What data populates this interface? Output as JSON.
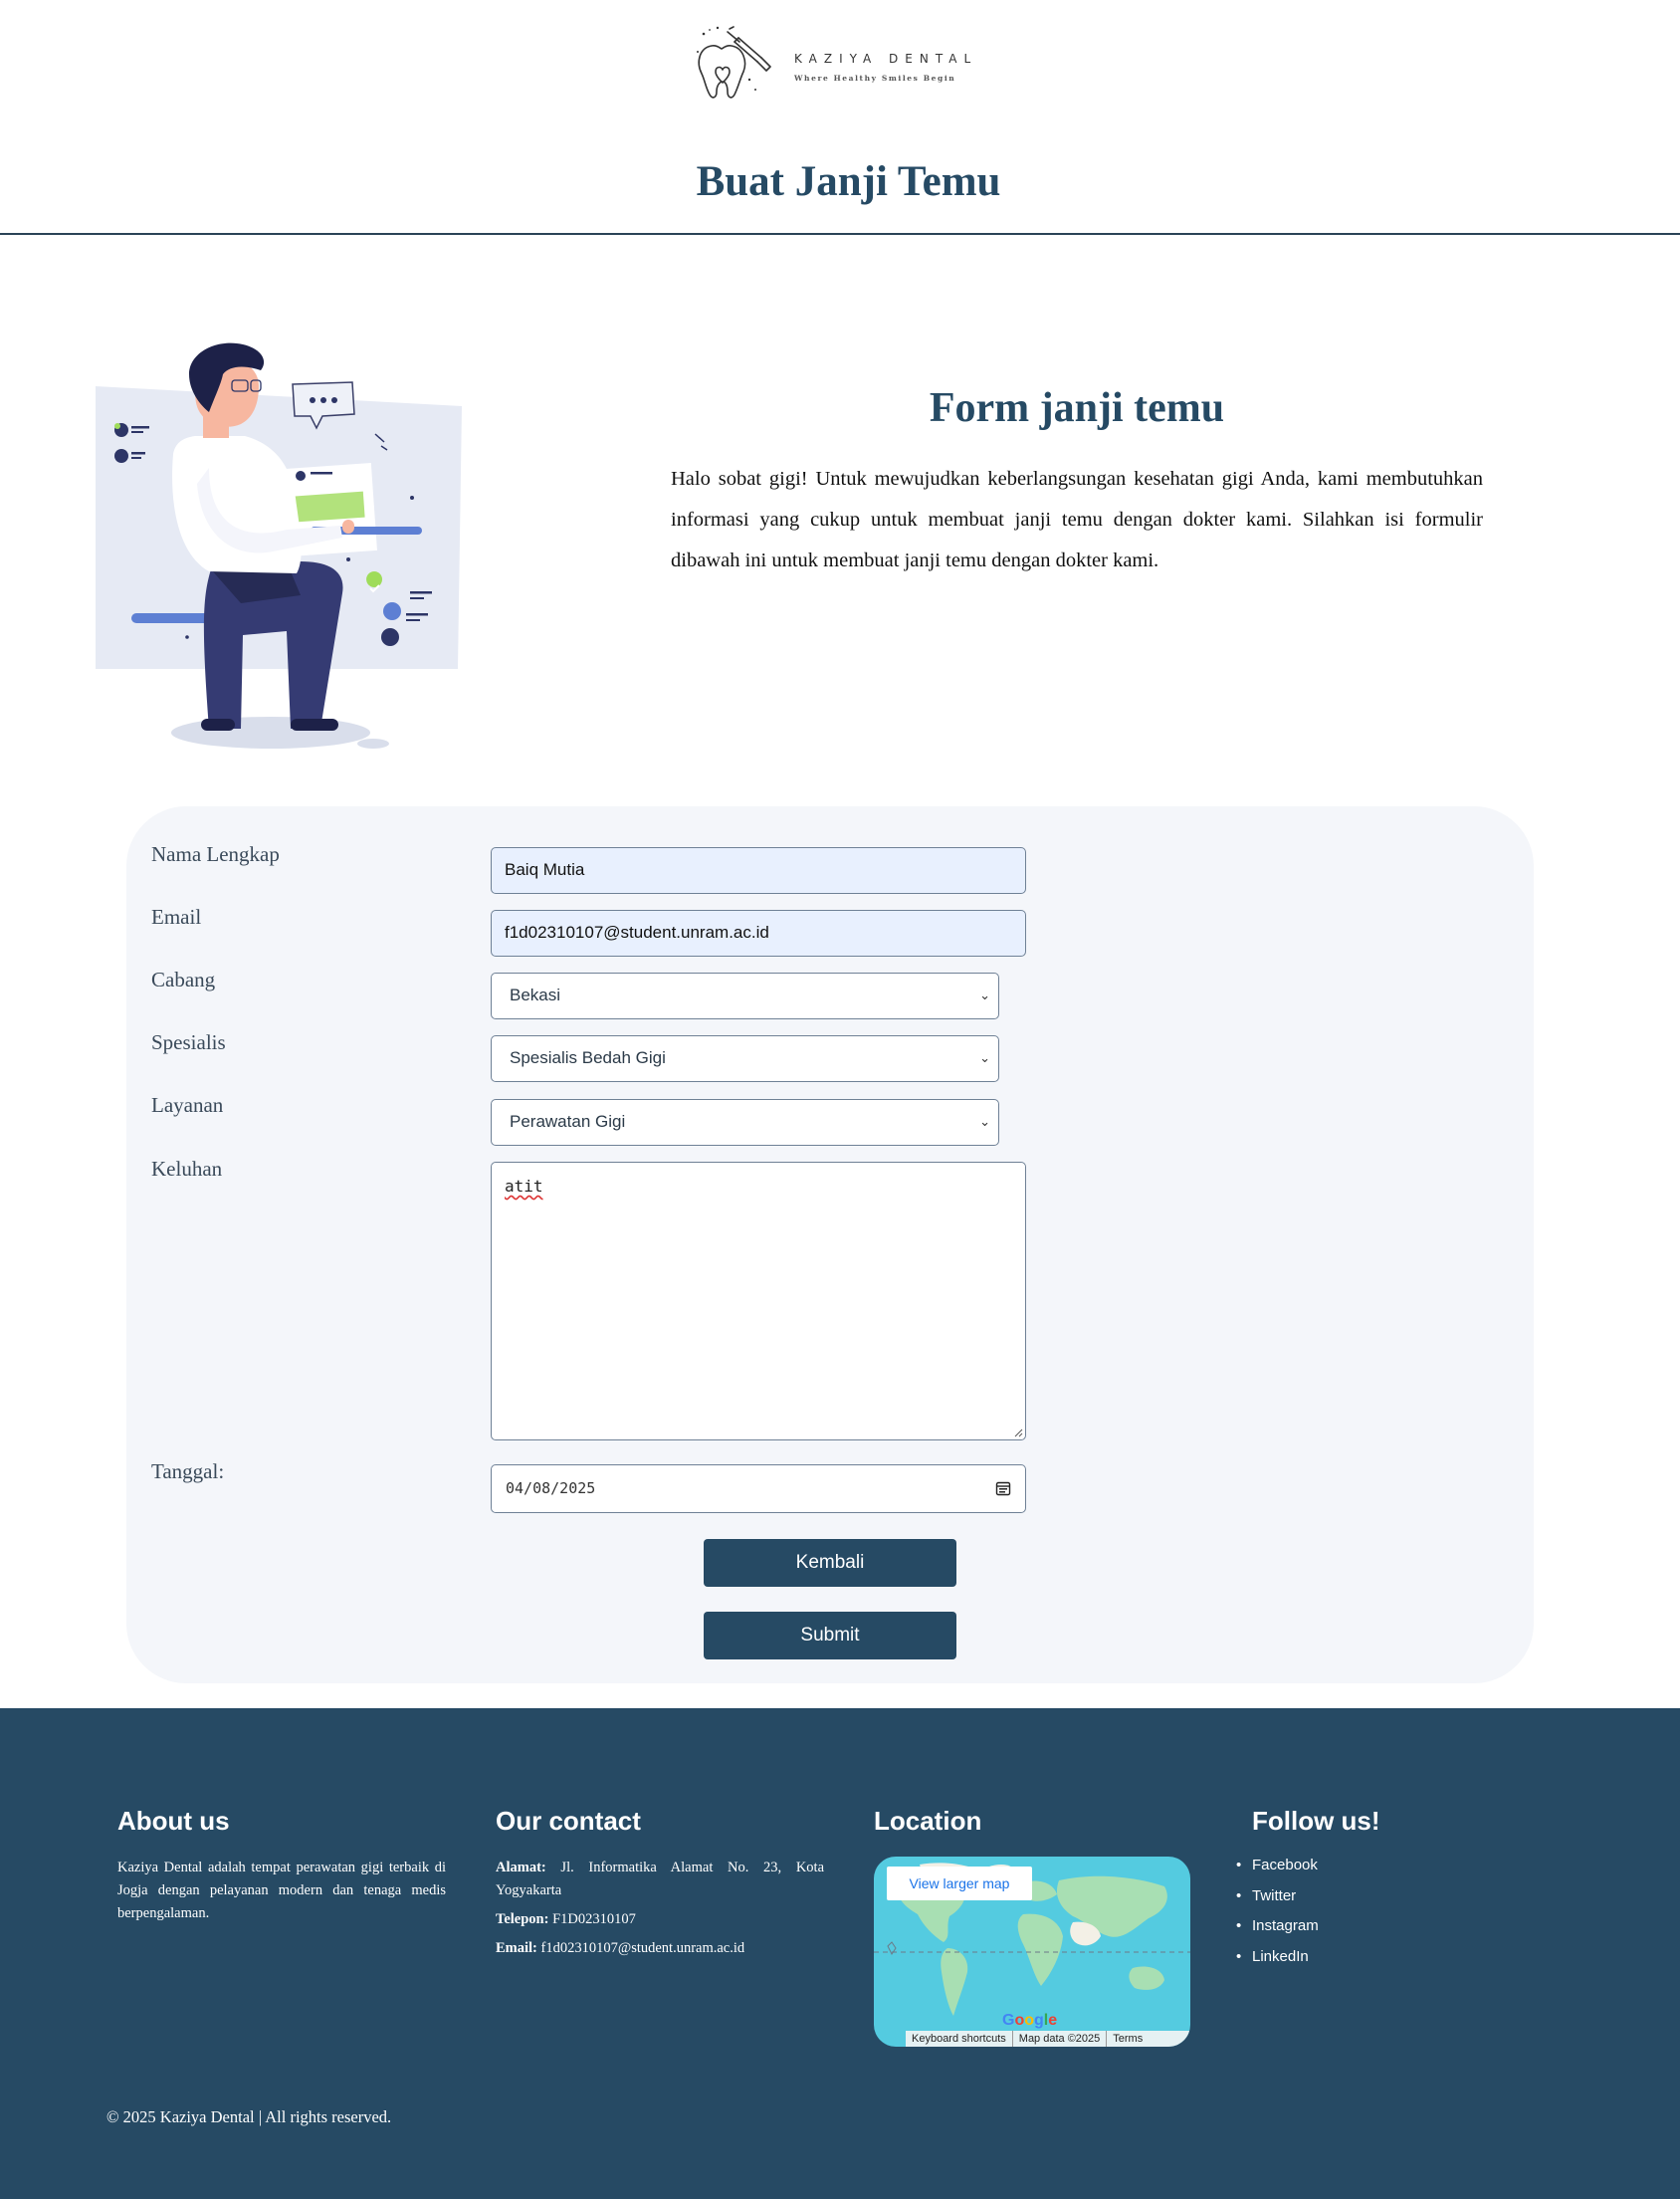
{
  "brand": {
    "name": "Kaziya Dental",
    "logo_text": "KAZIYA DENTAL",
    "tagline": "Where Healthy Smiles Begin"
  },
  "header": {
    "title": "Buat Janji Temu"
  },
  "hero": {
    "heading": "Form janji temu",
    "text": "Halo sobat gigi! Untuk mewujudkan keberlangsungan kesehatan gigi Anda, kami membutuhkan informasi yang cukup untuk membuat janji temu dengan dokter kami. Silahkan isi formulir dibawah ini untuk membuat janji temu dengan dokter kami."
  },
  "form": {
    "nama": {
      "label": "Nama Lengkap",
      "value": "Baiq Mutia"
    },
    "email": {
      "label": "Email",
      "value": "f1d02310107@student.unram.ac.id"
    },
    "cabang": {
      "label": "Cabang",
      "value": "Bekasi"
    },
    "spesialis": {
      "label": "Spesialis",
      "value": "Spesialis Bedah Gigi"
    },
    "layanan": {
      "label": "Layanan",
      "value": "Perawatan Gigi"
    },
    "keluhan": {
      "label": "Keluhan",
      "value": "atit"
    },
    "tanggal": {
      "label": "Tanggal:",
      "value": "04/08/2025"
    },
    "back_label": "Kembali",
    "submit_label": "Submit"
  },
  "footer": {
    "about": {
      "heading": "About us",
      "text": "Kaziya Dental adalah tempat perawatan gigi terbaik di Jogja dengan pelayanan modern dan tenaga medis berpengalaman."
    },
    "contact": {
      "heading": "Our contact",
      "address_label": "Alamat:",
      "address": "Jl. Informatika Alamat No. 23, Kota Yogyakarta",
      "phone_label": "Telepon:",
      "phone": "F1D02310107",
      "email_label": "Email:",
      "email": "f1d02310107@student.unram.ac.id"
    },
    "location": {
      "heading": "Location",
      "map_button": "View larger map",
      "map_logo": "Google",
      "map_shortcuts": "Keyboard shortcuts",
      "map_data": "Map data ©2025",
      "map_terms": "Terms"
    },
    "follow": {
      "heading": "Follow us!",
      "links": [
        "Facebook",
        "Twitter",
        "Instagram",
        "LinkedIn"
      ]
    },
    "copyright": "© 2025 Kaziya Dental | All rights reserved."
  },
  "colors": {
    "primary": "#264a64",
    "form_bg": "#f4f6fa",
    "autofill_bg": "#e8f0fe",
    "map_water": "#54cbe0"
  },
  "icons": [
    "tooth-logo-icon",
    "chevron-down-icon",
    "calendar-icon",
    "resize-grip-icon"
  ]
}
